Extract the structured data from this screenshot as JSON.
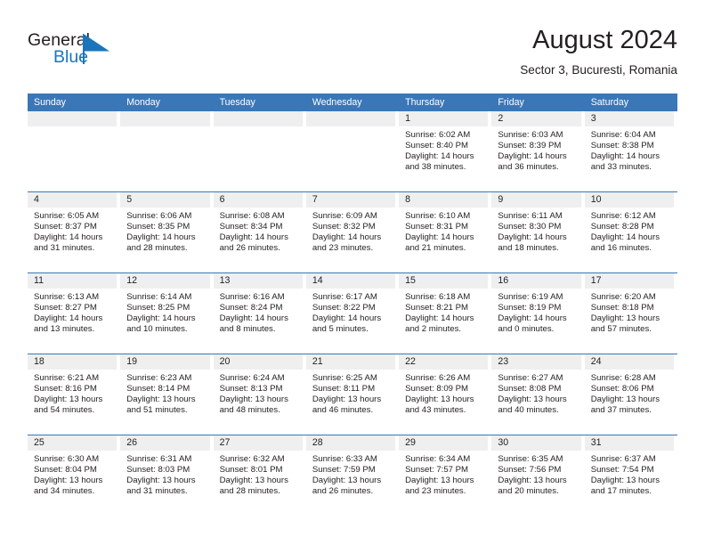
{
  "brand": {
    "name_part1": "General",
    "name_part2": "Blue",
    "accent_color": "#1b75bb"
  },
  "header": {
    "title": "August 2024",
    "subtitle": "Sector 3, Bucuresti, Romania"
  },
  "theme": {
    "header_blue": "#3a77b8",
    "daynum_strip": "#efefef",
    "text": "#231f20"
  },
  "weekdays": [
    "Sunday",
    "Monday",
    "Tuesday",
    "Wednesday",
    "Thursday",
    "Friday",
    "Saturday"
  ],
  "weeks": [
    [
      {
        "day": "",
        "empty": true
      },
      {
        "day": "",
        "empty": true
      },
      {
        "day": "",
        "empty": true
      },
      {
        "day": "",
        "empty": true
      },
      {
        "day": "1",
        "sunrise": "Sunrise: 6:02 AM",
        "sunset": "Sunset: 8:40 PM",
        "daylight1": "Daylight: 14 hours",
        "daylight2": "and 38 minutes."
      },
      {
        "day": "2",
        "sunrise": "Sunrise: 6:03 AM",
        "sunset": "Sunset: 8:39 PM",
        "daylight1": "Daylight: 14 hours",
        "daylight2": "and 36 minutes."
      },
      {
        "day": "3",
        "sunrise": "Sunrise: 6:04 AM",
        "sunset": "Sunset: 8:38 PM",
        "daylight1": "Daylight: 14 hours",
        "daylight2": "and 33 minutes."
      }
    ],
    [
      {
        "day": "4",
        "sunrise": "Sunrise: 6:05 AM",
        "sunset": "Sunset: 8:37 PM",
        "daylight1": "Daylight: 14 hours",
        "daylight2": "and 31 minutes."
      },
      {
        "day": "5",
        "sunrise": "Sunrise: 6:06 AM",
        "sunset": "Sunset: 8:35 PM",
        "daylight1": "Daylight: 14 hours",
        "daylight2": "and 28 minutes."
      },
      {
        "day": "6",
        "sunrise": "Sunrise: 6:08 AM",
        "sunset": "Sunset: 8:34 PM",
        "daylight1": "Daylight: 14 hours",
        "daylight2": "and 26 minutes."
      },
      {
        "day": "7",
        "sunrise": "Sunrise: 6:09 AM",
        "sunset": "Sunset: 8:32 PM",
        "daylight1": "Daylight: 14 hours",
        "daylight2": "and 23 minutes."
      },
      {
        "day": "8",
        "sunrise": "Sunrise: 6:10 AM",
        "sunset": "Sunset: 8:31 PM",
        "daylight1": "Daylight: 14 hours",
        "daylight2": "and 21 minutes."
      },
      {
        "day": "9",
        "sunrise": "Sunrise: 6:11 AM",
        "sunset": "Sunset: 8:30 PM",
        "daylight1": "Daylight: 14 hours",
        "daylight2": "and 18 minutes."
      },
      {
        "day": "10",
        "sunrise": "Sunrise: 6:12 AM",
        "sunset": "Sunset: 8:28 PM",
        "daylight1": "Daylight: 14 hours",
        "daylight2": "and 16 minutes."
      }
    ],
    [
      {
        "day": "11",
        "sunrise": "Sunrise: 6:13 AM",
        "sunset": "Sunset: 8:27 PM",
        "daylight1": "Daylight: 14 hours",
        "daylight2": "and 13 minutes."
      },
      {
        "day": "12",
        "sunrise": "Sunrise: 6:14 AM",
        "sunset": "Sunset: 8:25 PM",
        "daylight1": "Daylight: 14 hours",
        "daylight2": "and 10 minutes."
      },
      {
        "day": "13",
        "sunrise": "Sunrise: 6:16 AM",
        "sunset": "Sunset: 8:24 PM",
        "daylight1": "Daylight: 14 hours",
        "daylight2": "and 8 minutes."
      },
      {
        "day": "14",
        "sunrise": "Sunrise: 6:17 AM",
        "sunset": "Sunset: 8:22 PM",
        "daylight1": "Daylight: 14 hours",
        "daylight2": "and 5 minutes."
      },
      {
        "day": "15",
        "sunrise": "Sunrise: 6:18 AM",
        "sunset": "Sunset: 8:21 PM",
        "daylight1": "Daylight: 14 hours",
        "daylight2": "and 2 minutes."
      },
      {
        "day": "16",
        "sunrise": "Sunrise: 6:19 AM",
        "sunset": "Sunset: 8:19 PM",
        "daylight1": "Daylight: 14 hours",
        "daylight2": "and 0 minutes."
      },
      {
        "day": "17",
        "sunrise": "Sunrise: 6:20 AM",
        "sunset": "Sunset: 8:18 PM",
        "daylight1": "Daylight: 13 hours",
        "daylight2": "and 57 minutes."
      }
    ],
    [
      {
        "day": "18",
        "sunrise": "Sunrise: 6:21 AM",
        "sunset": "Sunset: 8:16 PM",
        "daylight1": "Daylight: 13 hours",
        "daylight2": "and 54 minutes."
      },
      {
        "day": "19",
        "sunrise": "Sunrise: 6:23 AM",
        "sunset": "Sunset: 8:14 PM",
        "daylight1": "Daylight: 13 hours",
        "daylight2": "and 51 minutes."
      },
      {
        "day": "20",
        "sunrise": "Sunrise: 6:24 AM",
        "sunset": "Sunset: 8:13 PM",
        "daylight1": "Daylight: 13 hours",
        "daylight2": "and 48 minutes."
      },
      {
        "day": "21",
        "sunrise": "Sunrise: 6:25 AM",
        "sunset": "Sunset: 8:11 PM",
        "daylight1": "Daylight: 13 hours",
        "daylight2": "and 46 minutes."
      },
      {
        "day": "22",
        "sunrise": "Sunrise: 6:26 AM",
        "sunset": "Sunset: 8:09 PM",
        "daylight1": "Daylight: 13 hours",
        "daylight2": "and 43 minutes."
      },
      {
        "day": "23",
        "sunrise": "Sunrise: 6:27 AM",
        "sunset": "Sunset: 8:08 PM",
        "daylight1": "Daylight: 13 hours",
        "daylight2": "and 40 minutes."
      },
      {
        "day": "24",
        "sunrise": "Sunrise: 6:28 AM",
        "sunset": "Sunset: 8:06 PM",
        "daylight1": "Daylight: 13 hours",
        "daylight2": "and 37 minutes."
      }
    ],
    [
      {
        "day": "25",
        "sunrise": "Sunrise: 6:30 AM",
        "sunset": "Sunset: 8:04 PM",
        "daylight1": "Daylight: 13 hours",
        "daylight2": "and 34 minutes."
      },
      {
        "day": "26",
        "sunrise": "Sunrise: 6:31 AM",
        "sunset": "Sunset: 8:03 PM",
        "daylight1": "Daylight: 13 hours",
        "daylight2": "and 31 minutes."
      },
      {
        "day": "27",
        "sunrise": "Sunrise: 6:32 AM",
        "sunset": "Sunset: 8:01 PM",
        "daylight1": "Daylight: 13 hours",
        "daylight2": "and 28 minutes."
      },
      {
        "day": "28",
        "sunrise": "Sunrise: 6:33 AM",
        "sunset": "Sunset: 7:59 PM",
        "daylight1": "Daylight: 13 hours",
        "daylight2": "and 26 minutes."
      },
      {
        "day": "29",
        "sunrise": "Sunrise: 6:34 AM",
        "sunset": "Sunset: 7:57 PM",
        "daylight1": "Daylight: 13 hours",
        "daylight2": "and 23 minutes."
      },
      {
        "day": "30",
        "sunrise": "Sunrise: 6:35 AM",
        "sunset": "Sunset: 7:56 PM",
        "daylight1": "Daylight: 13 hours",
        "daylight2": "and 20 minutes."
      },
      {
        "day": "31",
        "sunrise": "Sunrise: 6:37 AM",
        "sunset": "Sunset: 7:54 PM",
        "daylight1": "Daylight: 13 hours",
        "daylight2": "and 17 minutes."
      }
    ]
  ]
}
